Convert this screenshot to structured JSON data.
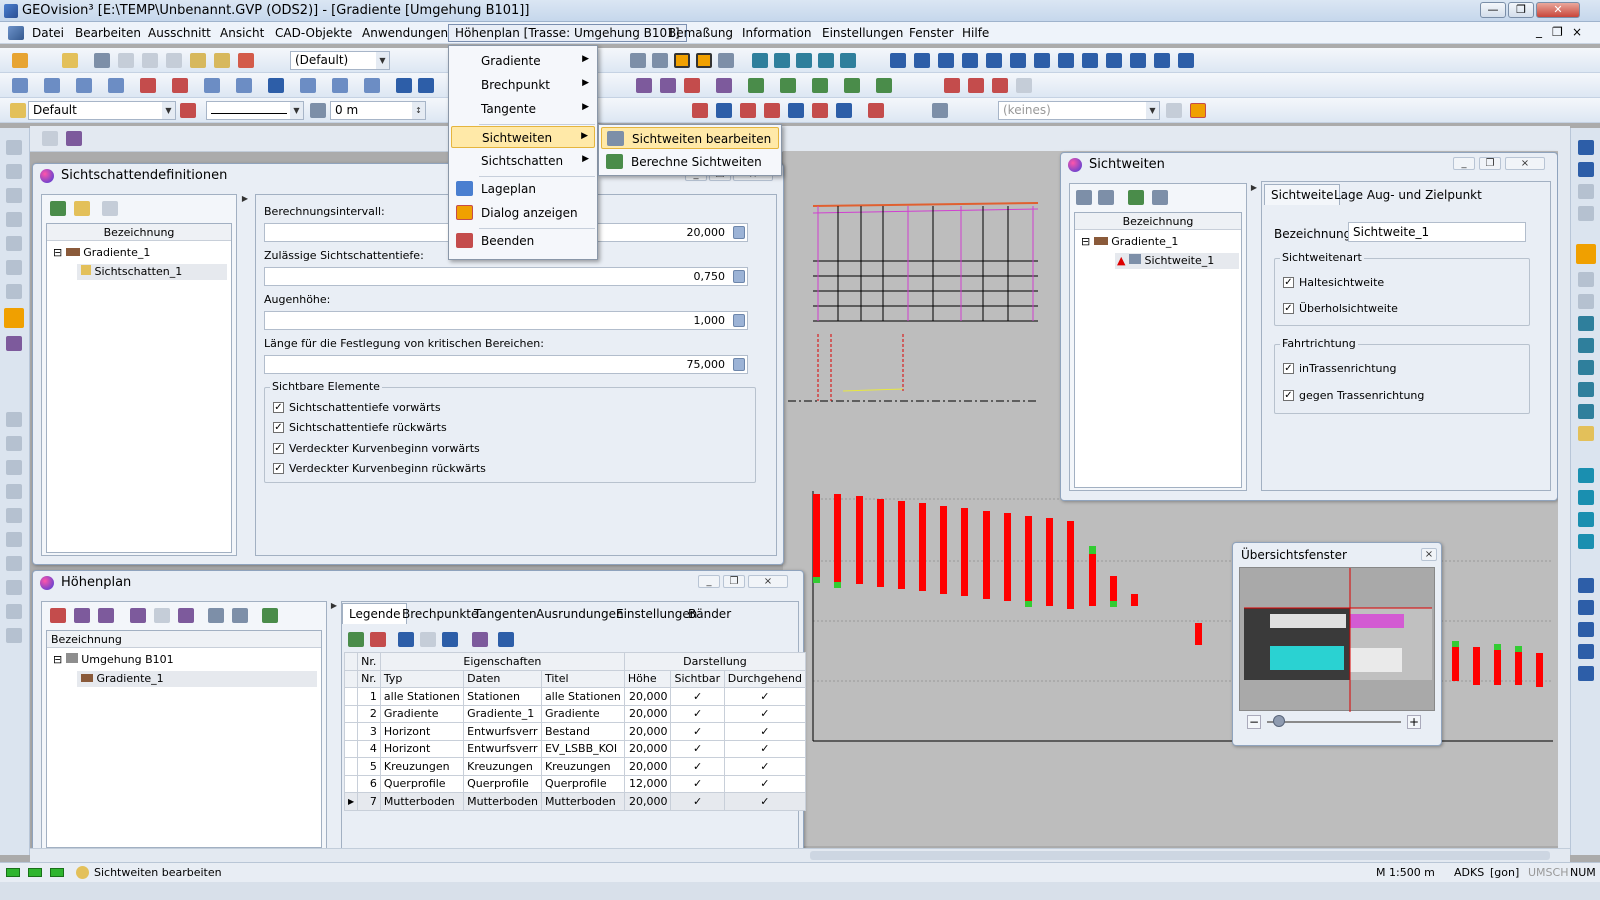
{
  "app": {
    "title": "GEOvision³  [E:\\TEMP\\Unbenannt.GVP (ODS2)] - [Gradiente [Umgehung B101]]",
    "win_buttons": [
      "—",
      "❐",
      "✕"
    ],
    "mdi_buttons": [
      "_",
      "❐",
      "×"
    ]
  },
  "menubar": [
    "Datei",
    "Bearbeiten",
    "Ausschnitt",
    "Ansicht",
    "CAD-Objekte",
    "Anwendungen",
    "Höhenplan [Trasse: Umgehung B101]",
    "Bemaßung",
    "Information",
    "Einstellungen",
    "Fenster",
    "Hilfe"
  ],
  "toolbar": {
    "layer_combo": "(Default)",
    "style_combo": "Default",
    "distance_value": "0 m",
    "keines_combo": "(keines)"
  },
  "dropdown_menu": {
    "items": [
      "Gradiente",
      "Brechpunkt",
      "Tangente",
      "Sichtweiten",
      "Sichtschatten",
      "Lageplan",
      "Dialog anzeigen",
      "Beenden"
    ],
    "submenu": [
      "Sichtweiten bearbeiten",
      "Berechne Sichtweiten"
    ]
  },
  "sichtschatten_panel": {
    "title": "Sichtschattendefinitionen",
    "tree_header": "Bezeichnung",
    "tree_root": "Gradiente_1",
    "tree_child": "Sichtschatten_1",
    "fields": [
      {
        "label": "Berechnungsintervall:",
        "value": "20,000"
      },
      {
        "label": "Zulässige Sichtschattentiefe:",
        "value": "0,750"
      },
      {
        "label": "Augenhöhe:",
        "value": "1,000"
      },
      {
        "label": "Länge für die Festlegung von kritischen Bereichen:",
        "value": "75,000"
      }
    ],
    "group_title": "Sichtbare Elemente",
    "checks": [
      "Sichtschattentiefe vorwärts",
      "Sichtschattentiefe rückwärts",
      "Verdeckter Kurvenbeginn vorwärts",
      "Verdeckter Kurvenbeginn rückwärts"
    ]
  },
  "hoehenplan_panel": {
    "title": "Höhenplan",
    "tree_header": "Bezeichnung",
    "tree_root": "Umgehung B101",
    "tree_child": "Gradiente_1",
    "tabs": [
      "Legende",
      "Brechpunkte",
      "Tangenten",
      "Ausrundungen",
      "Einstellungen",
      "Bänder"
    ],
    "group_headers": {
      "nr": "Nr.",
      "eigenschaften": "Eigenschaften",
      "darstellung": "Darstellung"
    },
    "columns": [
      "Nr.",
      "Typ",
      "Daten",
      "Titel",
      "Höhe",
      "Sichtbar",
      "Durchgehend"
    ],
    "rows": [
      {
        "nr": "1",
        "typ": "alle Stationen",
        "daten": "Stationen",
        "titel": "alle Stationen",
        "hoehe": "20,000"
      },
      {
        "nr": "2",
        "typ": "Gradiente",
        "daten": "Gradiente_1",
        "titel": "Gradiente",
        "hoehe": "20,000"
      },
      {
        "nr": "3",
        "typ": "Horizont",
        "daten": "Entwurfsverr",
        "titel": "Bestand",
        "hoehe": "20,000"
      },
      {
        "nr": "4",
        "typ": "Horizont",
        "daten": "Entwurfsverr",
        "titel": "EV_LSBB_KOI",
        "hoehe": "20,000"
      },
      {
        "nr": "5",
        "typ": "Kreuzungen",
        "daten": "Kreuzungen",
        "titel": "Kreuzungen",
        "hoehe": "20,000"
      },
      {
        "nr": "6",
        "typ": "Querprofile",
        "daten": "Querprofile",
        "titel": "Querprofile",
        "hoehe": "12,000"
      },
      {
        "nr": "7",
        "typ": "Mutterboden",
        "daten": "Mutterboden",
        "titel": "Mutterboden",
        "hoehe": "20,000"
      }
    ],
    "check_mark": "✓"
  },
  "sichtweiten_panel": {
    "title": "Sichtweiten",
    "tree_header": "Bezeichnung",
    "tree_root": "Gradiente_1",
    "tree_child": "Sichtweite_1",
    "tabs": [
      "Sichtweite",
      "Lage Aug- und Zielpunkt"
    ],
    "bezeichnung_label": "Bezeichnung:",
    "bezeichnung_value": "Sichtweite_1",
    "group1_title": "Sichtweitenart",
    "group1_checks": [
      "Haltesichtweite",
      "Überholsichtweite"
    ],
    "group2_title": "Fahrtrichtung",
    "group2_checks": [
      "inTrassenrichtung",
      "gegen Trassenrichtung"
    ]
  },
  "overview_panel": {
    "title": "Übersichtsfenster",
    "zoom_minus": "−",
    "zoom_plus": "+"
  },
  "statusbar": {
    "message": "Sichtweiten bearbeiten",
    "scale": "M 1:500  m",
    "mode": "ADKS",
    "unit": "[gon]",
    "umsch": "UMSCH",
    "num": "NUM"
  },
  "colors": {
    "bar_red": "#ff0000",
    "bar_green": "#33cc33",
    "menu_highlight": "#ffe9a8"
  }
}
